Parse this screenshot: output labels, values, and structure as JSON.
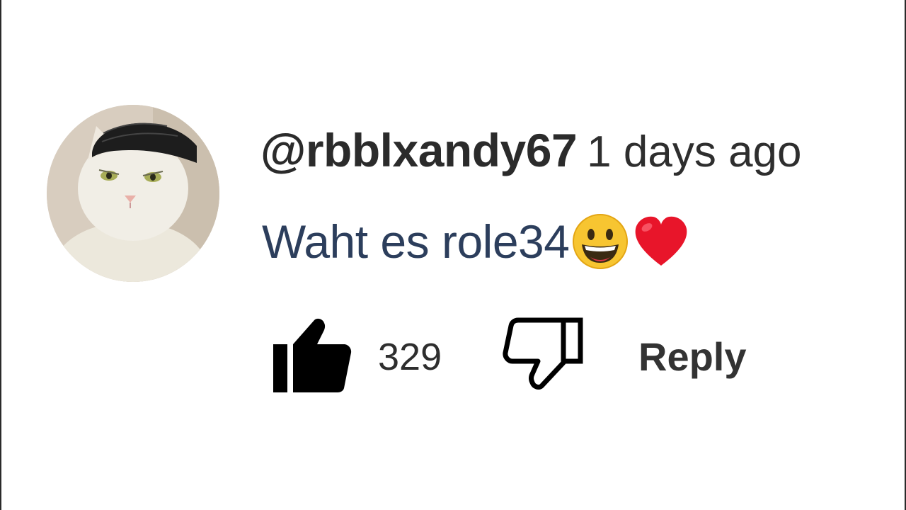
{
  "comment": {
    "username": "@rbblxandy67",
    "timestamp": "1 days ago",
    "text": "Waht es role34",
    "emojis": [
      "grinning-face-emoji",
      "red-heart-emoji"
    ]
  },
  "actions": {
    "like_count": "329",
    "reply_label": "Reply"
  },
  "icons": {
    "like": "thumbs-up-filled-icon",
    "dislike": "thumbs-down-outline-icon"
  },
  "colors": {
    "username": "#2b2b2b",
    "comment_text": "#2c3e5c",
    "heart": "#e8152a",
    "emoji_face": "#f7c531"
  }
}
